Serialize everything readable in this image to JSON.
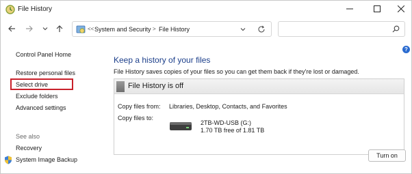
{
  "window": {
    "title": "File History",
    "controls": [
      "minimize",
      "maximize",
      "close"
    ]
  },
  "address": {
    "overflow": "<<",
    "breadcrumbs": [
      "System and Security",
      "File History"
    ],
    "separator": ">",
    "search_placeholder": ""
  },
  "leftnav": {
    "home": "Control Panel Home",
    "items": [
      "Restore personal files",
      "Select drive",
      "Exclude folders",
      "Advanced settings"
    ],
    "see_also_header": "See also",
    "see_also": [
      "Recovery",
      "System Image Backup"
    ]
  },
  "main": {
    "title": "Keep a history of your files",
    "description": "File History saves copies of your files so you can get them back if they're lost or damaged.",
    "status": "File History is off",
    "copy_from_label": "Copy files from:",
    "copy_from_value": "Libraries, Desktop, Contacts, and Favorites",
    "copy_to_label": "Copy files to:",
    "drive_name": "2TB-WD-USB (G:)",
    "drive_space": "1.70 TB free of 1.81 TB",
    "turn_on_label": "Turn on",
    "help": "?"
  },
  "colors": {
    "title_blue": "#1b3e8a",
    "highlight_red": "#c8202a",
    "help_blue": "#2a6bd0"
  },
  "icons": [
    "file-history-icon",
    "back-arrow-icon",
    "forward-arrow-icon",
    "chevron-down-icon",
    "up-arrow-icon",
    "control-panel-icon",
    "refresh-icon",
    "search-icon",
    "shield-icon",
    "drive-icon",
    "help-icon"
  ]
}
